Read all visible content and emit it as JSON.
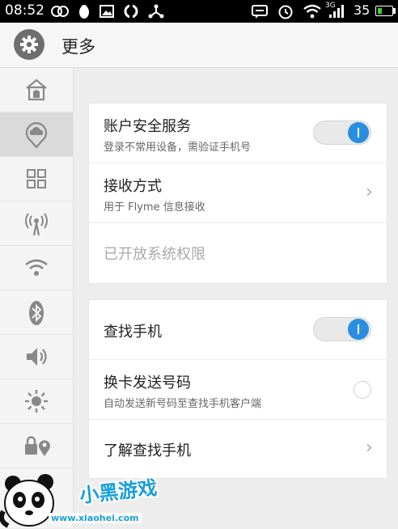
{
  "status_bar": {
    "time": "08:52",
    "network": "3G",
    "battery": "35",
    "battery_level": 0.35,
    "left_icons": [
      "infinity-icon",
      "penguin-icon",
      "image-icon",
      "sync-icon",
      "share-node-icon"
    ],
    "right_icons": [
      "message-icon",
      "alarm-icon",
      "wifi-icon",
      "signal-icon"
    ]
  },
  "header": {
    "title": "更多",
    "icon": "gear-icon"
  },
  "sidebar": {
    "items": [
      {
        "icon": "home-icon",
        "active": false
      },
      {
        "icon": "cloud-location-icon",
        "active": true
      },
      {
        "icon": "grid-icon",
        "active": false
      },
      {
        "icon": "hotspot-icon",
        "active": false
      },
      {
        "icon": "wifi-icon",
        "active": false
      },
      {
        "icon": "bluetooth-icon",
        "active": false
      },
      {
        "icon": "volume-icon",
        "active": false
      },
      {
        "icon": "brightness-icon",
        "active": false
      },
      {
        "icon": "lock-location-icon",
        "active": false
      }
    ]
  },
  "account_card": {
    "security": {
      "title": "账户安全服务",
      "subtitle": "登录不常用设备，需验证手机号",
      "enabled": true
    },
    "receive": {
      "title": "接收方式",
      "subtitle": "用于 Flyme 信息接收"
    },
    "permissions": {
      "title": "已开放系统权限"
    }
  },
  "find_card": {
    "find_phone": {
      "title": "查找手机",
      "enabled": true
    },
    "sim_change": {
      "title": "换卡发送号码",
      "subtitle": "自动发送新号码至查找手机客户端",
      "checked": false
    },
    "learn_more": {
      "title": "了解查找手机"
    }
  },
  "watermark": {
    "brand": "小黑游戏",
    "url": "www.xiaohei.com"
  },
  "colors": {
    "accent": "#2a8ee0",
    "watermark": "#1a9fd8"
  }
}
